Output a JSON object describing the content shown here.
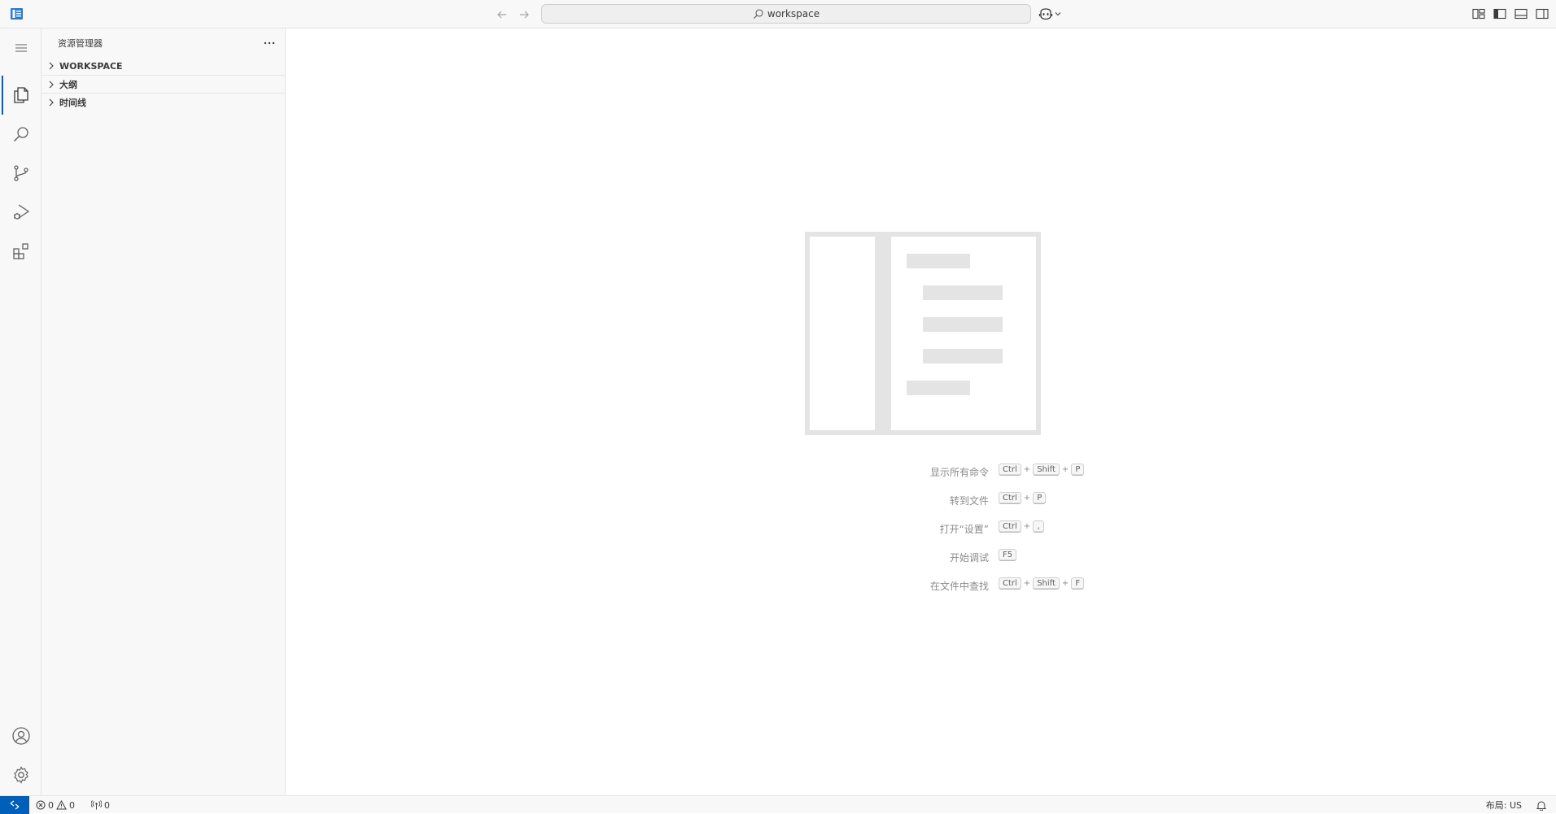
{
  "titlebar": {
    "search_text": "workspace",
    "icons": {
      "logo": "vscode-logo-icon",
      "back": "arrow-left-icon",
      "forward": "arrow-right-icon",
      "search": "search-icon",
      "copilot": "copilot-icon",
      "copilot_menu": "chevron-down-icon",
      "customize_layout": "customize-layout-icon",
      "toggle_primary_sidebar": "toggle-primary-sidebar-icon",
      "toggle_panel": "toggle-panel-icon",
      "toggle_secondary_sidebar": "toggle-secondary-sidebar-icon"
    }
  },
  "activitybar": {
    "items": [
      {
        "name": "menu",
        "icon": "menu-icon"
      },
      {
        "name": "explorer",
        "icon": "files-icon",
        "active": true
      },
      {
        "name": "search",
        "icon": "search-icon"
      },
      {
        "name": "source-control",
        "icon": "source-control-icon"
      },
      {
        "name": "run-debug",
        "icon": "run-debug-icon"
      },
      {
        "name": "extensions",
        "icon": "extensions-icon"
      }
    ],
    "bottom": [
      {
        "name": "accounts",
        "icon": "account-icon"
      },
      {
        "name": "manage",
        "icon": "gear-icon"
      }
    ]
  },
  "sidebar": {
    "title": "资源管理器",
    "sections": [
      {
        "label": "WORKSPACE"
      },
      {
        "label": "大纲"
      },
      {
        "label": "时间线"
      }
    ]
  },
  "editor": {
    "watermark_icon": "editor-watermark-icon",
    "shortcuts": [
      {
        "label": "显示所有命令",
        "keys": [
          "Ctrl",
          "Shift",
          "P"
        ]
      },
      {
        "label": "转到文件",
        "keys": [
          "Ctrl",
          "P"
        ]
      },
      {
        "label": "打开“设置”",
        "keys": [
          "Ctrl",
          ","
        ]
      },
      {
        "label": "开始调试",
        "keys": [
          "F5"
        ]
      },
      {
        "label": "在文件中查找",
        "keys": [
          "Ctrl",
          "Shift",
          "F"
        ]
      }
    ],
    "key_separator": "+"
  },
  "statusbar": {
    "errors": "0",
    "warnings": "0",
    "ports": "0",
    "layout": "布局: US",
    "icons": {
      "remote": "remote-icon",
      "error": "error-icon",
      "warning": "warning-icon",
      "ports": "radio-tower-icon",
      "bell": "bell-icon"
    }
  },
  "colors": {
    "accent": "#005fb8",
    "chrome_bg": "#f8f8f8",
    "border": "#e5e5e5",
    "watermark": "#e4e4e4"
  }
}
